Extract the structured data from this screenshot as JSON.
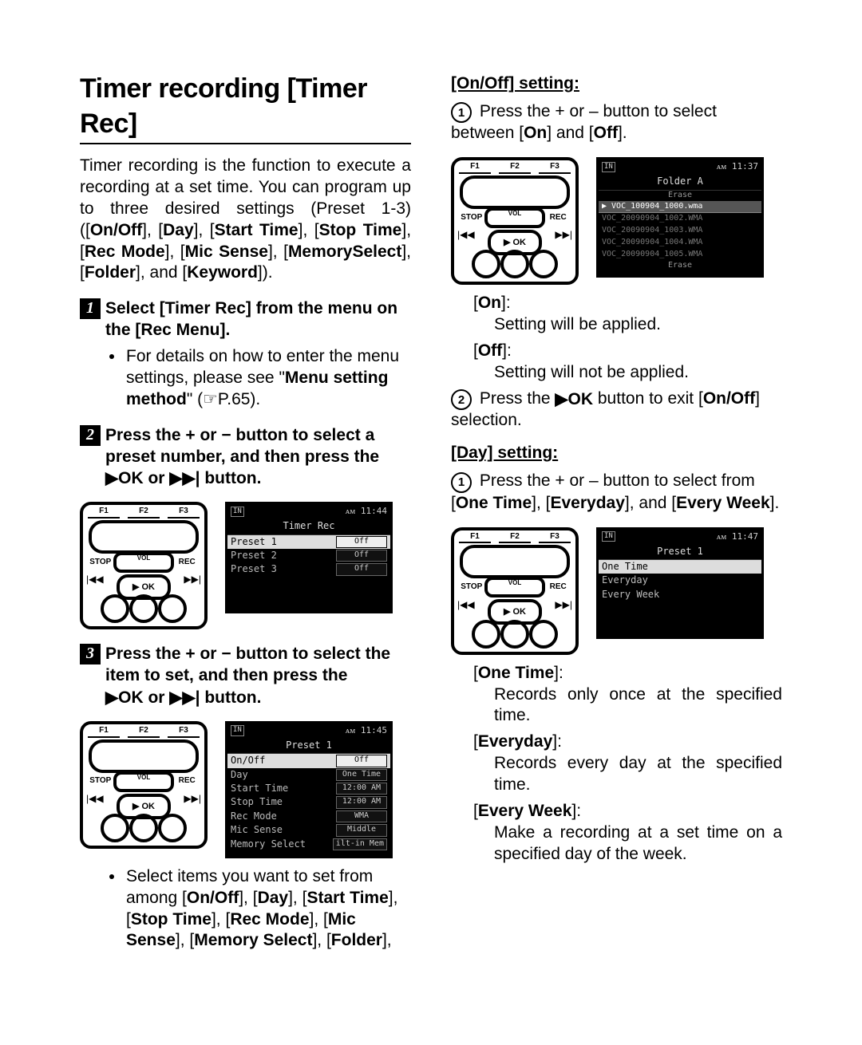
{
  "left": {
    "title": "Timer recording [Timer Rec]",
    "intro_a": "Timer recording is the function to execute a recording at a set time. You can program up to three desired settings (Preset 1-3) ([",
    "intro_b": "On/Off",
    "intro_c": "], [",
    "intro_d": "Day",
    "intro_e": "], [",
    "intro_f": "Start Time",
    "intro_g": "], [",
    "intro_h": "Stop Time",
    "intro_i": "], [",
    "intro_j": "Rec Mode",
    "intro_k": "], [",
    "intro_l": "Mic Sense",
    "intro_m": "], [",
    "intro_n": "MemorySelect",
    "intro_o": "], [",
    "intro_p": "Folder",
    "intro_q": "], and [",
    "intro_r": "Keyword",
    "intro_s": "]).",
    "step1_a": "Select [",
    "step1_b": "Timer Rec",
    "step1_c": "] from the menu on the [",
    "step1_d": "Rec Menu",
    "step1_e": "].",
    "step1_bul_a": "For details on how to enter the menu settings, please see \"",
    "step1_bul_b": "Menu setting method",
    "step1_bul_c": "\" (☞P.65).",
    "step2_a": "Press the + or − button to select a preset number, and then press the ",
    "step2_b": "▶OK or ▶▶| button.",
    "lcd1": {
      "clock": "ᴀᴍ 11:44",
      "title": "Timer Rec",
      "rows": [
        {
          "label": "Preset 1",
          "val": "Off",
          "sel": true
        },
        {
          "label": "Preset 2",
          "val": "Off"
        },
        {
          "label": "Preset 3",
          "val": "Off"
        }
      ]
    },
    "step3_a": "Press the + or − button to select the item to set, and then press the ",
    "step3_b": "▶OK or ▶▶| button.",
    "lcd2": {
      "clock": "ᴀᴍ 11:45",
      "title": "Preset 1",
      "rows": [
        {
          "label": "On/Off",
          "val": "Off",
          "sel": true
        },
        {
          "label": "Day",
          "val": "One Time"
        },
        {
          "label": "Start Time",
          "val": "12:00 AM"
        },
        {
          "label": "Stop Time",
          "val": "12:00 AM"
        },
        {
          "label": "Rec Mode",
          "val": "WMA"
        },
        {
          "label": "Mic Sense",
          "val": "Middle"
        },
        {
          "label": "Memory Select",
          "val": "ilt-in Mem"
        }
      ]
    },
    "step3_bul_a": "Select items you want to set from among [",
    "step3_items": [
      "On/Off",
      "Day",
      "Start Time",
      "Stop Time",
      "Rec Mode",
      "Mic Sense",
      "Memory Select",
      "Folder"
    ],
    "step3_bul_b": "],"
  },
  "right": {
    "onoff": {
      "head": "[On/Off] setting:",
      "s1_a": "Press the + or – button to select between [",
      "s1_b": "On",
      "s1_c": "] and [",
      "s1_d": "Off",
      "s1_e": "].",
      "lcd": {
        "clock": "ᴀᴍ 11:37",
        "title": "Folder A",
        "rows": [
          {
            "label": "▶ VOC_100904_1000.wma",
            "hl": true
          },
          {
            "label": "VOC_20090904_1002.WMA"
          },
          {
            "label": "VOC_20090904_1003.WMA"
          },
          {
            "label": "VOC_20090904_1004.WMA"
          },
          {
            "label": "VOC_20090904_1005.WMA"
          }
        ],
        "erase_top": "Erase",
        "erase_bot": "Erase"
      },
      "on_l": "[",
      "on_b": "On",
      "on_r": "]:",
      "on_d": "Setting will be applied.",
      "off_l": "[",
      "off_b": "Off",
      "off_r": "]:",
      "off_d": "Setting will not be applied.",
      "s2_a": "Press the ",
      "s2_b": "▶OK",
      "s2_c": " button to exit [",
      "s2_d": "On/Off",
      "s2_e": "] selection."
    },
    "day": {
      "head": "[Day] setting:",
      "s1_a": "Press the + or – button to select from [",
      "s1_b": "One Time",
      "s1_c": "], [",
      "s1_d": "Everyday",
      "s1_e": "], and [",
      "s1_f": "Every Week",
      "s1_g": "].",
      "lcd": {
        "clock": "ᴀᴍ 11:47",
        "title": "Preset 1",
        "rows": [
          {
            "label": "One Time",
            "sel": true
          },
          {
            "label": "Everyday"
          },
          {
            "label": "Every Week"
          }
        ]
      },
      "one_l": "[",
      "one_b": "One Time",
      "one_r": "]:",
      "one_d": "Records only once at the specified time.",
      "ev_l": "[",
      "ev_b": "Everyday",
      "ev_r": "]:",
      "ev_d": "Records every day at the specified time.",
      "ew_l": "[",
      "ew_b": "Every Week",
      "ew_r": "]:",
      "ew_d": "Make a recording at a set time on a specified day of the week."
    }
  },
  "dev": {
    "f1": "F1",
    "f2": "F2",
    "f3": "F3",
    "stop": "STOP",
    "rec": "REC",
    "ok": "▶ OK",
    "l": "|◀◀",
    "r": "▶▶|"
  }
}
